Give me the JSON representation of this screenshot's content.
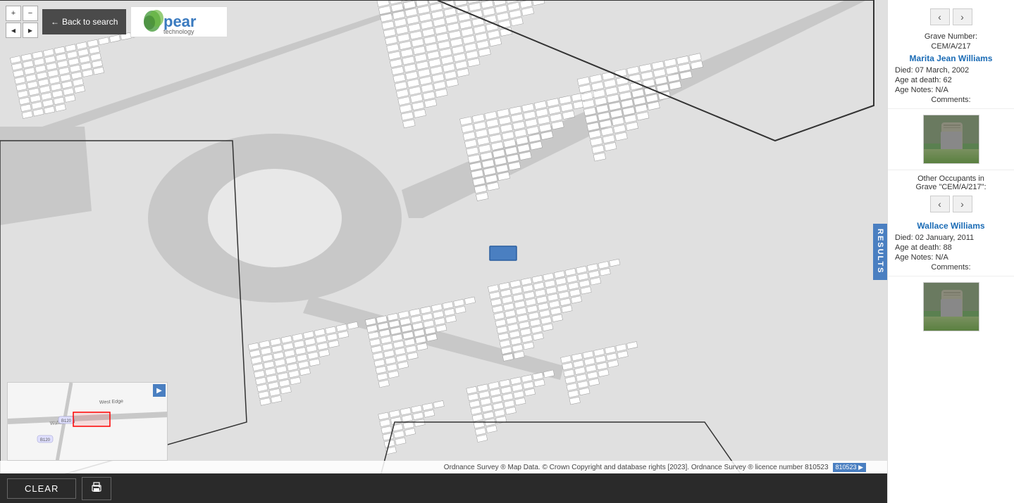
{
  "toolbar": {
    "back_label": "Back to search",
    "back_arrow": "←"
  },
  "logo": {
    "text": "pear",
    "brand": "technology",
    "leaf_symbol": "🌿"
  },
  "results_tab": {
    "label": "RESULTS"
  },
  "result1": {
    "grave_number_label": "Grave Number:",
    "grave_number": "CEM/A/217",
    "name": "Marita Jean Williams",
    "died_label": "Died: 07 March, 2002",
    "age_label": "Age at death: 62",
    "age_notes_label": "Age Notes: N/A",
    "comments_label": "Comments:"
  },
  "other_occupants": {
    "title": "Other Occupants in",
    "grave_ref": "Grave \"CEM/A/217\":"
  },
  "result2": {
    "name": "Wallace Williams",
    "died_label": "Died: 02 January, 2011",
    "age_label": "Age at death: 88",
    "age_notes_label": "Age Notes: N/A",
    "comments_label": "Comments:"
  },
  "bottom_bar": {
    "clear_label": "CLEAR",
    "print_icon": "🖶"
  },
  "attribution": {
    "text": "Ordnance Survey ® Map Data. © Crown Copyright and database rights [2023]. Ordnance Survey ® licence number 810523"
  },
  "minimap": {
    "expand_icon": "▶"
  },
  "nav": {
    "up": "▲",
    "down": "▼",
    "left": "◀",
    "right": "▶",
    "zoom_in": "+",
    "zoom_out": "−"
  }
}
